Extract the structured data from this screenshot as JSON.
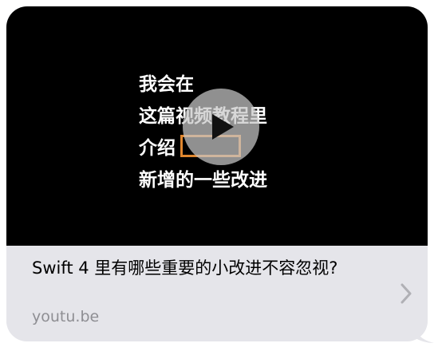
{
  "video": {
    "caption_lines": [
      "我会在",
      "这篇视频教程里",
      "介绍",
      "新增的一些改进"
    ],
    "play_icon": "play-icon"
  },
  "link": {
    "title": "Swift 4 里有哪些重要的小改进不容忽视?",
    "domain": "youtu.be",
    "chevron_icon": "chevron-right-icon"
  },
  "colors": {
    "bubble_bg": "#e5e5ea",
    "video_bg": "#000000",
    "domain_text": "#8e8e93",
    "highlight_box": "#e0872f"
  }
}
